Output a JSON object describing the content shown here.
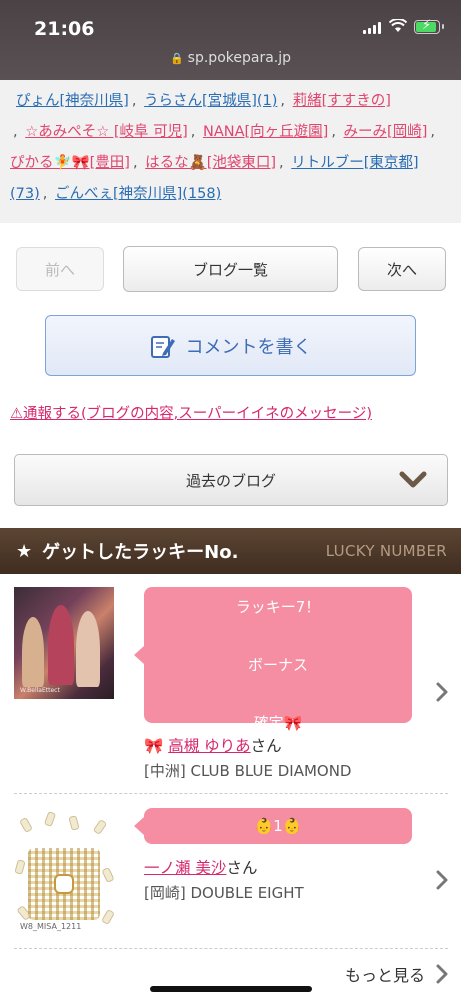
{
  "status": {
    "time": "21:06",
    "url": "sp.pokepara.jp"
  },
  "links": [
    {
      "text": "ぴょん[神奈川県]",
      "color": "blue"
    },
    {
      "text": "うらさん[宮城県](1)",
      "color": "blue"
    },
    {
      "text": "莉緒[すすきの]",
      "color": "pink"
    },
    {
      "text": "☆あみぺそ☆ [岐阜 可児]",
      "color": "pink"
    },
    {
      "text": "NANA[向ヶ丘遊園]",
      "color": "pink"
    },
    {
      "text": "みーみ[岡崎]",
      "color": "pink"
    },
    {
      "text": "ぴかる🧚🎀[豊田]",
      "color": "pink"
    },
    {
      "text": "はるな🧸[池袋東口]",
      "color": "pink"
    },
    {
      "text": "リトルブー[東京都](73)",
      "color": "blue"
    },
    {
      "text": "ごんべぇ[神奈川県](158)",
      "color": "blue"
    }
  ],
  "nav": {
    "prev": "前へ",
    "list": "ブログ一覧",
    "next": "次へ"
  },
  "comment": {
    "label": "コメントを書く"
  },
  "report": {
    "label": "⚠通報する(ブログの内容,スーパーイイネのメッセージ)"
  },
  "past": {
    "label": "過去のブログ"
  },
  "lucky": {
    "title": "ゲットしたラッキーNo.",
    "subtitle": "LUCKY NUMBER",
    "items": [
      {
        "bubble_lines": [
          "ラッキー7！",
          "ボーナス",
          "確定🎀"
        ],
        "name_prefix": "🎀 ",
        "name": "高槻 ゆりあ",
        "suffix": "さん",
        "club": "[中洲] CLUB BLUE DIAMOND",
        "photo_caption": "W.BellaEttect"
      },
      {
        "bubble_lines": [
          "👶1👶"
        ],
        "name_prefix": "",
        "name": "一ノ瀬 美沙",
        "suffix": "さん",
        "club": "[岡崎] DOUBLE EIGHT",
        "photo_caption": "W8_MISA_1211"
      }
    ],
    "more": "もっと見る"
  },
  "colors": {
    "bubble": "#f58ea3",
    "link_blue": "#2a6db3",
    "link_pink": "#e0456e",
    "header": "#4c3829"
  }
}
